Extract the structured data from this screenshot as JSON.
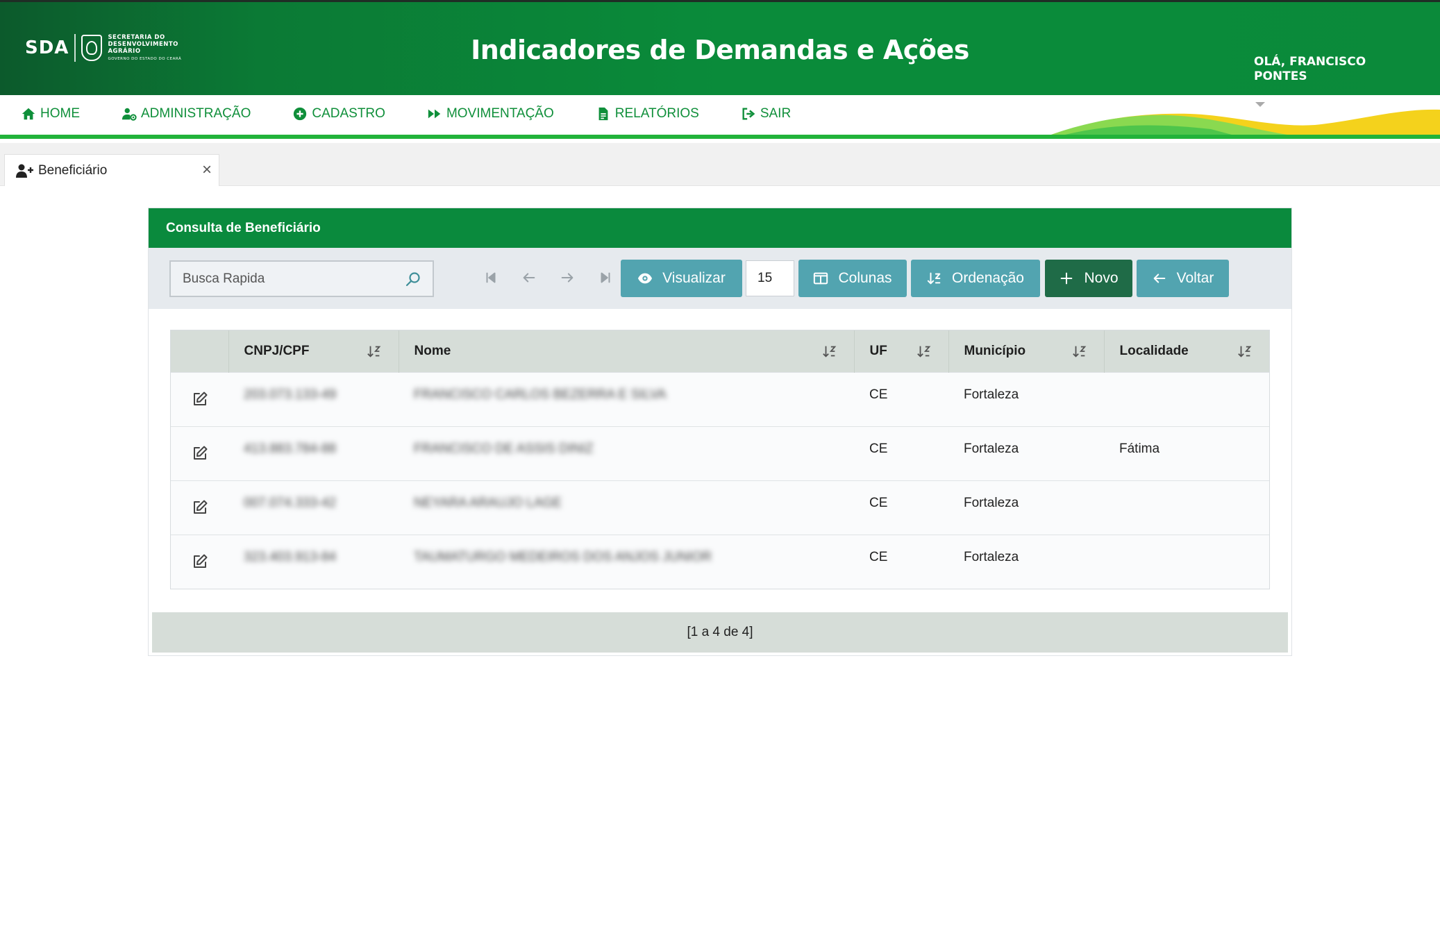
{
  "header": {
    "logo_abbr": "SDA",
    "logo_line1": "SECRETARIA DO",
    "logo_line2": "DESENVOLVIMENTO",
    "logo_line3": "AGRÁRIO",
    "logo_sub": "GOVERNO DO ESTADO DO CEARÁ",
    "title": "Indicadores de Demandas e Ações",
    "greeting_line1": "OLÁ, FRANCISCO",
    "greeting_line2": "PONTES"
  },
  "nav": {
    "items": [
      {
        "label": "HOME",
        "icon": "home-icon"
      },
      {
        "label": "ADMINISTRAÇÃO",
        "icon": "user-gear-icon"
      },
      {
        "label": "CADASTRO",
        "icon": "plus-circle-icon"
      },
      {
        "label": "MOVIMENTAÇÃO",
        "icon": "fast-forward-icon"
      },
      {
        "label": "RELATÓRIOS",
        "icon": "document-icon"
      },
      {
        "label": "SAIR",
        "icon": "sign-out-icon"
      }
    ]
  },
  "tab": {
    "label": "Beneficiário",
    "close": "×"
  },
  "panel": {
    "title": "Consulta de Beneficiário",
    "search_placeholder": "Busca Rapida",
    "page_size": "15",
    "buttons": {
      "view": "Visualizar",
      "columns": "Colunas",
      "order": "Ordenação",
      "new": "Novo",
      "back": "Voltar"
    },
    "columns": [
      "",
      "CNPJ/CPF",
      "Nome",
      "UF",
      "Município",
      "Localidade"
    ],
    "rows": [
      {
        "cpf": "203.073.133-49",
        "nome": "FRANCISCO CARLOS BEZERRA E SILVA",
        "uf": "CE",
        "municipio": "Fortaleza",
        "localidade": ""
      },
      {
        "cpf": "413.883.784-88",
        "nome": "FRANCISCO DE ASSIS DINIZ",
        "uf": "CE",
        "municipio": "Fortaleza",
        "localidade": "Fátima"
      },
      {
        "cpf": "007.074.333-42",
        "nome": "NEYARA ARAUJO LAGE",
        "uf": "CE",
        "municipio": "Fortaleza",
        "localidade": ""
      },
      {
        "cpf": "323.403.913-84",
        "nome": "TAUMATURGO MEDEIROS DOS ANJOS JUNIOR",
        "uf": "CE",
        "municipio": "Fortaleza",
        "localidade": ""
      }
    ],
    "footer": "[1 a 4 de 4]"
  },
  "colors": {
    "header_green": "#0a8a3d",
    "nav_green": "#0f8f3a",
    "button_teal": "#52a4b0",
    "button_dark": "#1f6b47"
  }
}
